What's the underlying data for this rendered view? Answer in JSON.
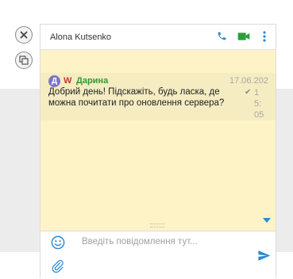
{
  "chat": {
    "contact_name": "Alona Kutsenko"
  },
  "message": {
    "avatar_letter": "Д",
    "os_badge": "W",
    "sender": "Дарина",
    "date": "17.06.202",
    "time": "15:05",
    "text": "Добрий день! Підскажіть, будь ласка, де можна почитати про оновлення сервера?"
  },
  "input": {
    "placeholder": "Введіть повідомлення тут..."
  },
  "icons": {
    "close": "close-icon",
    "popout": "popout-icon",
    "phone": "phone-icon",
    "video": "video-camera-icon",
    "menu": "more-vertical-icon",
    "emoji": "emoji-icon",
    "attach": "paperclip-icon",
    "send": "send-icon",
    "scroll": "chevron-down-icon"
  },
  "colors": {
    "chat_bg": "#fdf3c6",
    "message_bg": "#f6ecc1",
    "accent_blue": "#2a8ad4",
    "accent_green": "#2e9e3a",
    "sender_color": "#2f9a2f",
    "badge_color": "#c0392b",
    "avatar_color": "#7d75c8"
  }
}
